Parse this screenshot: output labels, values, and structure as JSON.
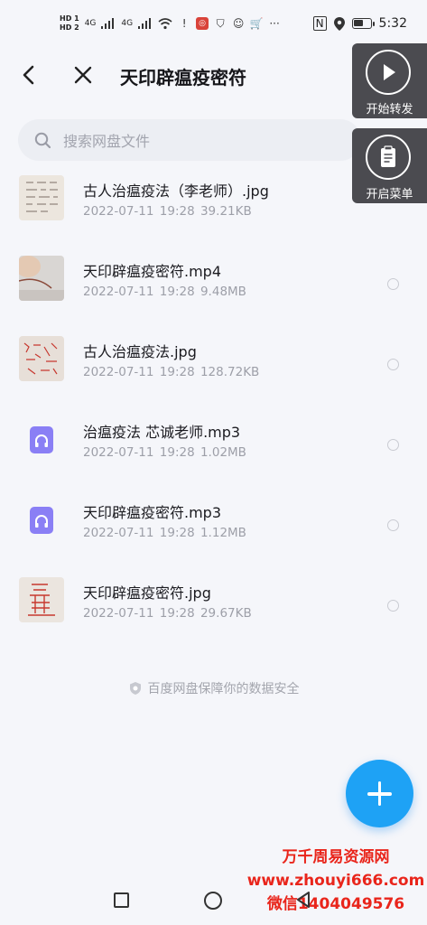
{
  "status_bar": {
    "hd1": "HD 1",
    "hd2": "HD 2",
    "net1": "4G",
    "net2": "4G",
    "time": "5:32",
    "battery_level": 0.6
  },
  "header": {
    "title": "天印辟瘟疫密符",
    "back_icon": "chevron-left-icon",
    "close_icon": "close-icon"
  },
  "search": {
    "placeholder": "搜索网盘文件"
  },
  "files": [
    {
      "name": "古人治瘟疫法（李老师）.jpg",
      "date": "2022-07-11",
      "time": "19:28",
      "size": "39.21KB",
      "type": "image"
    },
    {
      "name": "天印辟瘟疫密符.mp4",
      "date": "2022-07-11",
      "time": "19:28",
      "size": "9.48MB",
      "type": "video"
    },
    {
      "name": "古人治瘟疫法.jpg",
      "date": "2022-07-11",
      "time": "19:28",
      "size": "128.72KB",
      "type": "image"
    },
    {
      "name": "治瘟疫法 芯诚老师.mp3",
      "date": "2022-07-11",
      "time": "19:28",
      "size": "1.02MB",
      "type": "audio"
    },
    {
      "name": "天印辟瘟疫密符.mp3",
      "date": "2022-07-11",
      "time": "19:28",
      "size": "1.12MB",
      "type": "audio"
    },
    {
      "name": "天印辟瘟疫密符.jpg",
      "date": "2022-07-11",
      "time": "19:28",
      "size": "29.67KB",
      "type": "image"
    }
  ],
  "footer_note": "百度网盘保障你的数据安全",
  "float_buttons": {
    "start_forward": "开始转发",
    "open_menu": "开启菜单"
  },
  "watermark": {
    "line1": "万千周易资源网",
    "line2": "www.zhouyi666.com",
    "line3": "微信1404049576"
  },
  "colors": {
    "accent": "#1ea2f5",
    "audio_icon": "#8a7ff5",
    "watermark": "#e9251b"
  }
}
